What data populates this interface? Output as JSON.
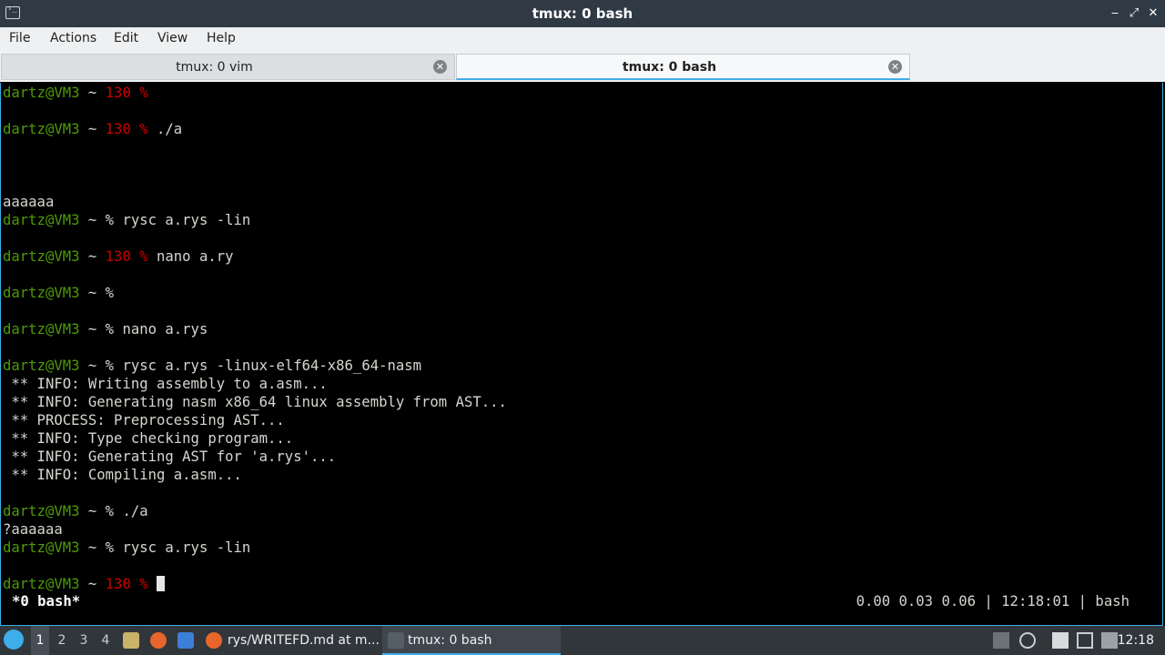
{
  "window": {
    "title": "tmux: 0 bash",
    "minimize": "‒",
    "maximize": "⤢",
    "close": "✕"
  },
  "menu": [
    "File",
    "Actions",
    "Edit",
    "View",
    "Help"
  ],
  "tabs": [
    {
      "label": "tmux: 0 vim",
      "close": "✕"
    },
    {
      "label": "tmux: 0 bash",
      "close": "✕"
    }
  ],
  "terminal": {
    "prompt_user": "dartz@VM3",
    "prompt_tilde": " ~ ",
    "lines": [
      {
        "code": "130 %",
        "cmd": ""
      },
      {
        "code": "130 %",
        "cmd": " ./a"
      },
      {
        "out": "aaaaaa"
      },
      {
        "code": "%",
        "cmd": " rysc a.rys -lin"
      },
      {
        "code": "130 %",
        "cmd": " nano a.ry"
      },
      {
        "code": "%",
        "cmd": ""
      },
      {
        "code": "%",
        "cmd": " nano a.rys"
      },
      {
        "code": "%",
        "cmd": " rysc a.rys -linux-elf64-x86_64-nasm"
      },
      {
        "out": " ** INFO: Writing assembly to a.asm..."
      },
      {
        "out": " ** INFO: Generating nasm x86_64 linux assembly from AST..."
      },
      {
        "out": " ** PROCESS: Preprocessing AST..."
      },
      {
        "out": " ** INFO: Type checking program..."
      },
      {
        "out": " ** INFO: Generating AST for 'a.rys'..."
      },
      {
        "out": " ** INFO: Compiling a.asm..."
      },
      {
        "code": "%",
        "cmd": " ./a"
      },
      {
        "out": "?aaaaaa"
      },
      {
        "code": "%",
        "cmd": " rysc a.rys -lin"
      },
      {
        "code": "130 %",
        "cmd": " "
      }
    ],
    "status_left": "*0 bash*",
    "status_right": "0.00 0.03 0.06 | 12:18:01 | bash"
  },
  "taskbar": {
    "workspaces": [
      "1",
      "2",
      "3",
      "4"
    ],
    "tasks": [
      "rys/WRITEFD.md at m...",
      "tmux: 0 bash"
    ],
    "clock": "12:18"
  },
  "colors": {
    "prompt_green": "#4e9a06",
    "error_red": "#cc0000",
    "accent": "#3daee9"
  }
}
